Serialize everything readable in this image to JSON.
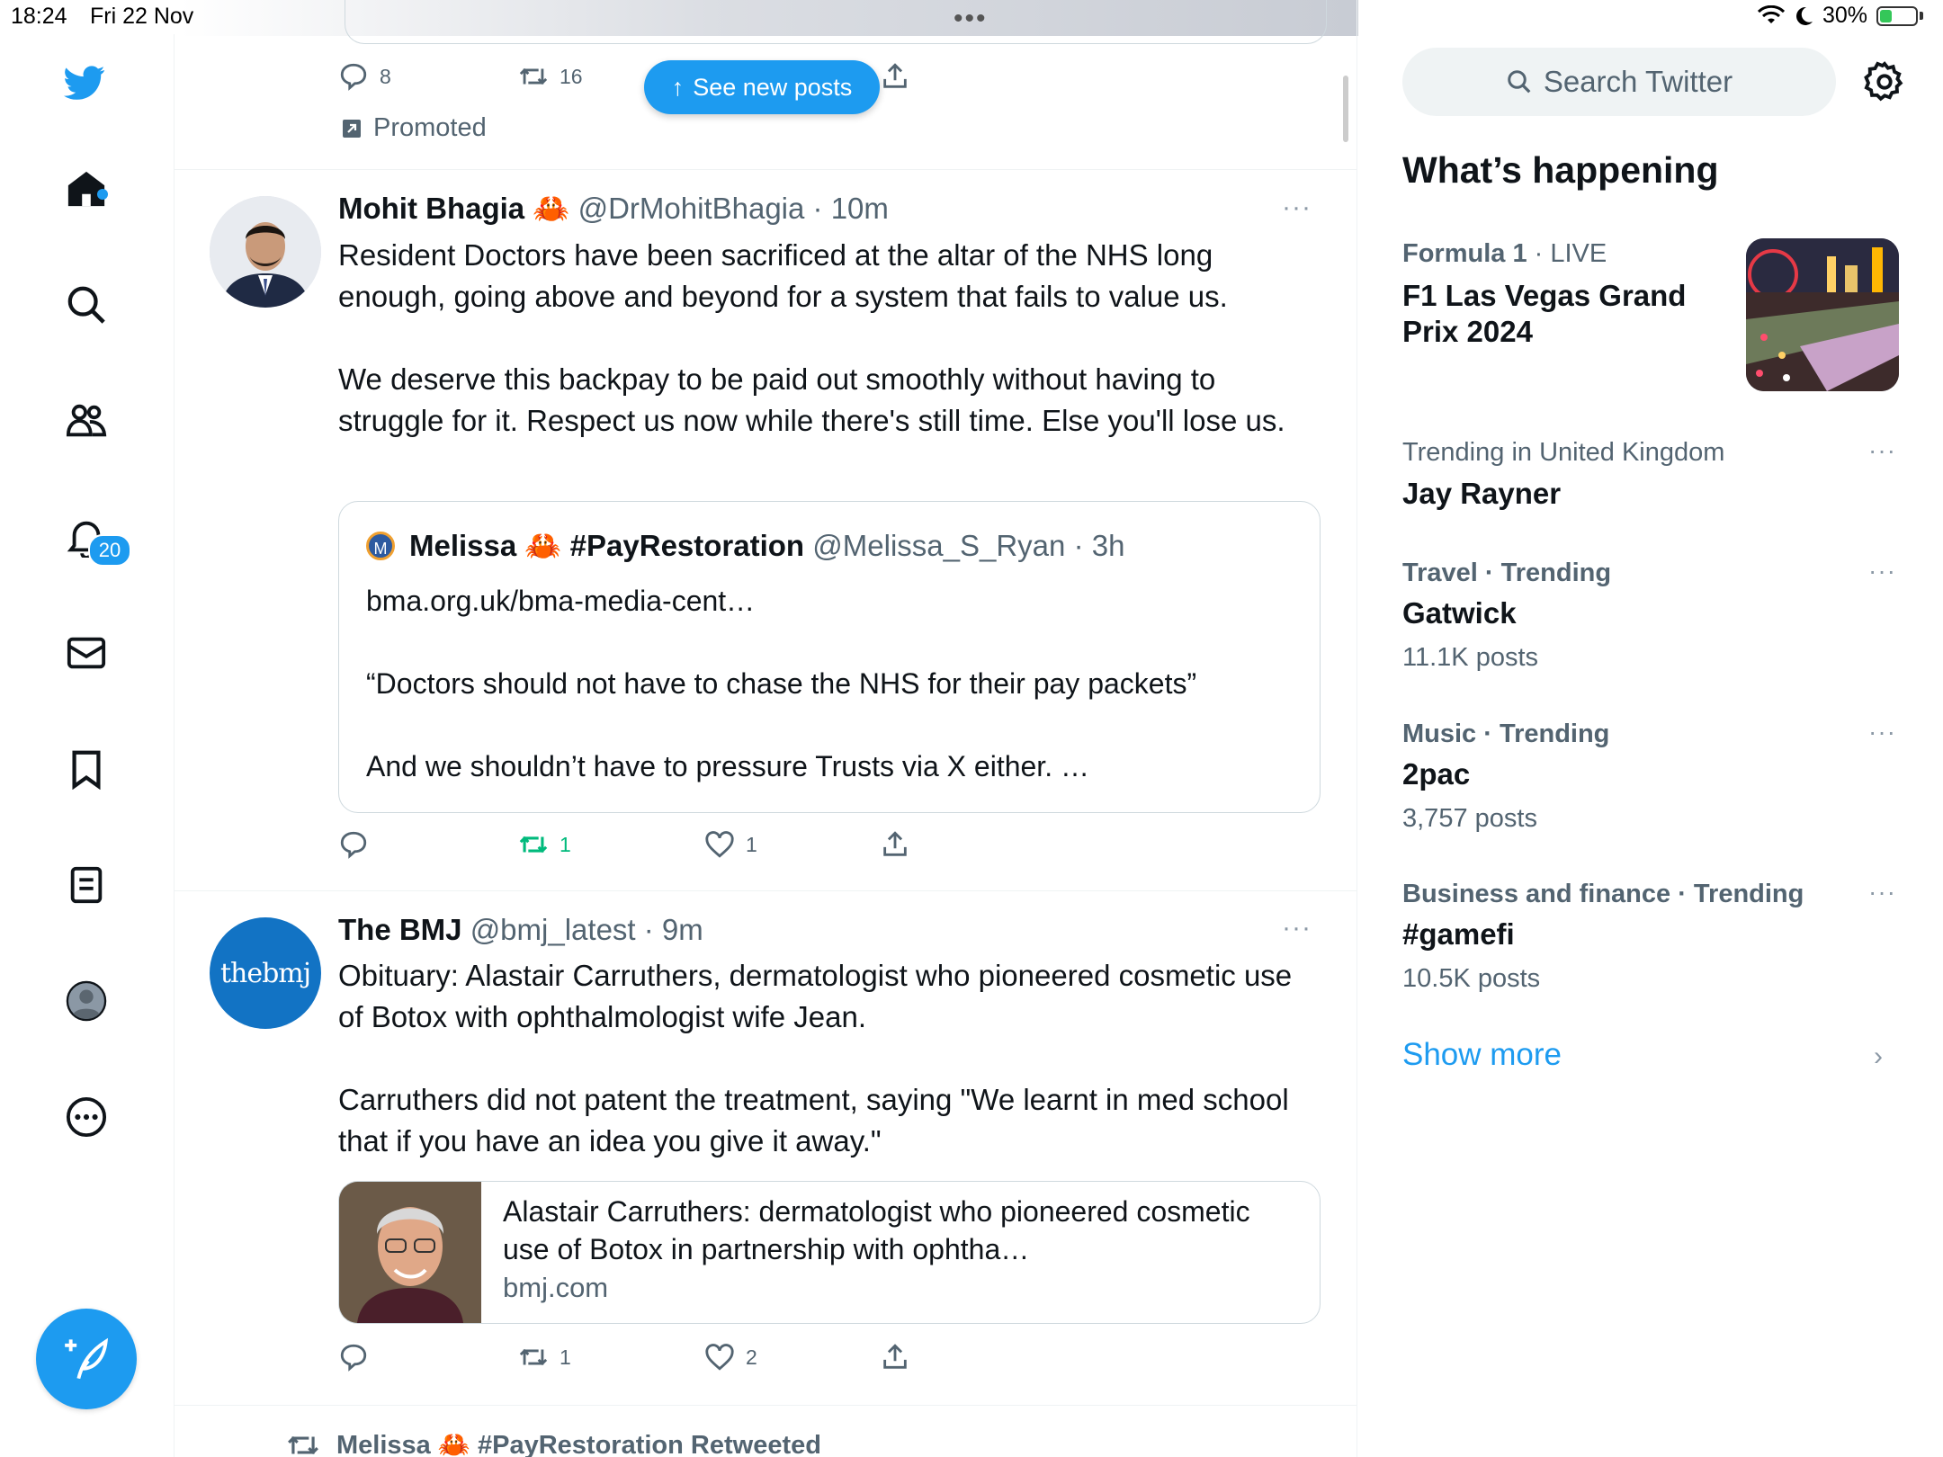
{
  "status_bar": {
    "time": "18:24",
    "date": "Fri 22 Nov",
    "battery": "30%"
  },
  "nav": {
    "notifications_badge": "20"
  },
  "feed": {
    "promo": {
      "reply_count": "8",
      "retweet_count": "16",
      "promoted_label": "Promoted"
    },
    "see_new_posts": "See new posts",
    "tweets": [
      {
        "name": "Mohit Bhagia",
        "emoji": "🦀",
        "handle": "@DrMohitBhagia",
        "time": "· 10m",
        "paragraphs": [
          "Resident Doctors have been sacrificed at the altar of the NHS long enough, going above and beyond for a system that fails to value us.",
          "We deserve this backpay to be paid out smoothly without having to struggle for it. Respect us now while there's still time. Else you'll lose us."
        ],
        "quote": {
          "avatar_letter": "M",
          "name": "Melissa 🦀 #PayRestoration",
          "handle": "@Melissa_S_Ryan",
          "time": "· 3h",
          "paragraphs": [
            "bma.org.uk/bma-media-cent…",
            "“Doctors should not have to chase the NHS for their pay packets”",
            "And we shouldn’t have to pressure Trusts via X either. …"
          ]
        },
        "retweets": "1",
        "likes": "1"
      },
      {
        "name": "The BMJ",
        "handle": "@bmj_latest",
        "time": "· 9m",
        "avatar_text": "thebmj",
        "paragraphs": [
          "Obituary: Alastair Carruthers, dermatologist who pioneered cosmetic use of Botox with ophthalmologist wife Jean.",
          "Carruthers did not patent the treatment, saying \"We learnt in med school that if you have an idea you give it away.\""
        ],
        "card": {
          "title": "Alastair Carruthers: dermatologist who pioneered cosmetic use of Botox in partnership with ophtha…",
          "domain": "bmj.com"
        },
        "retweets": "1",
        "likes": "2"
      }
    ],
    "retweeted_by": "Melissa 🦀 #PayRestoration Retweeted"
  },
  "sidebar": {
    "search_placeholder": "Search Twitter",
    "title": "What’s happening",
    "trends": [
      {
        "meta_bold": "Formula 1",
        "meta": " · LIVE",
        "name": "F1 Las Vegas Grand Prix 2024"
      },
      {
        "meta": "Trending in United Kingdom",
        "name": "Jay Rayner"
      },
      {
        "meta": "Travel · Trending",
        "name": "Gatwick",
        "count": "11.1K posts"
      },
      {
        "meta": "Music · Trending",
        "name": "2pac",
        "count": "3,757 posts"
      },
      {
        "meta": "Business and finance · Trending",
        "name": "#gamefi",
        "count": "10.5K posts"
      }
    ],
    "show_more": "Show more"
  },
  "colors": {
    "accent": "#1d9bf0",
    "retweet_green": "#00ba7c",
    "muted": "#536471"
  }
}
